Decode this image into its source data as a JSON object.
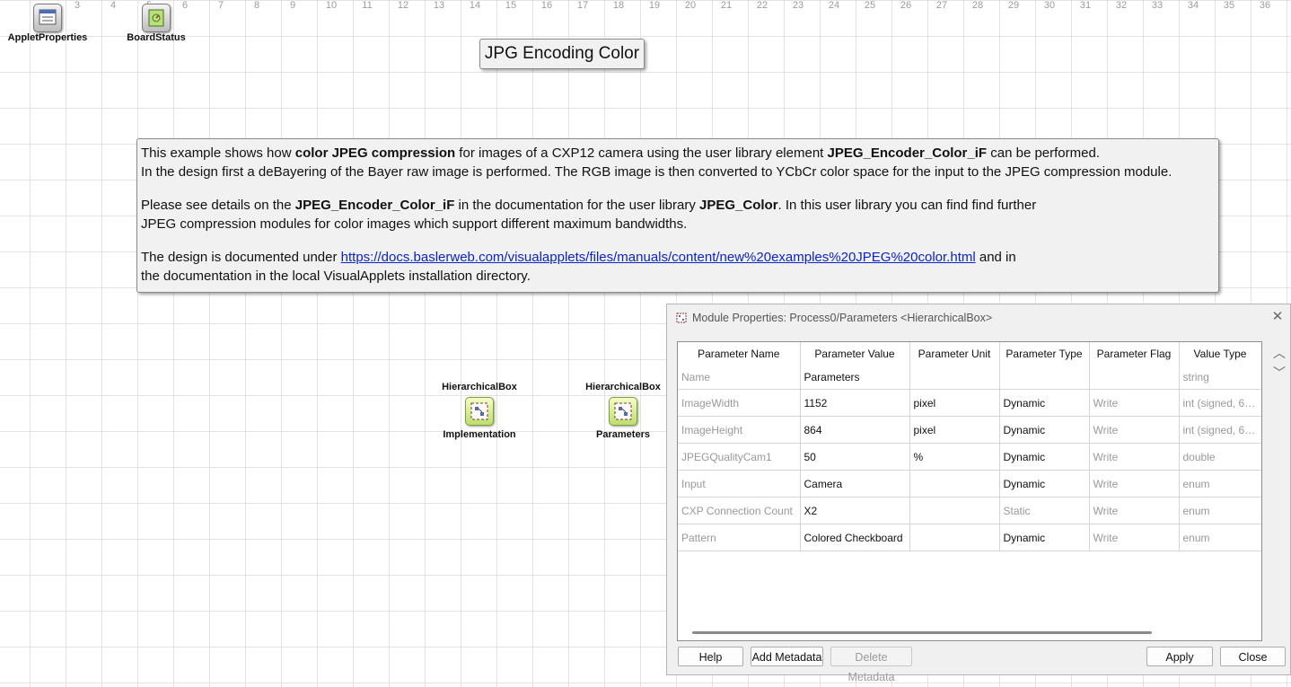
{
  "ruler": [
    "3",
    "4",
    "5",
    "6",
    "7",
    "8",
    "9",
    "10",
    "11",
    "12",
    "13",
    "14",
    "15",
    "16",
    "17",
    "18",
    "19",
    "20",
    "21",
    "22",
    "23",
    "24",
    "25",
    "26",
    "27",
    "28",
    "29",
    "30",
    "31",
    "32",
    "33",
    "34",
    "35",
    "36"
  ],
  "canvas": {
    "modules": {
      "applet_properties": "AppletProperties",
      "board_status": "BoardStatus",
      "hbox1_type": "HierarchicalBox",
      "hbox1_name": "Implementation",
      "hbox2_type": "HierarchicalBox",
      "hbox2_name": "Parameters"
    },
    "title": "JPG Encoding Color",
    "note": {
      "l1_a": "This example shows how ",
      "l1_b": "color JPEG compression",
      "l1_c": " for images of a CXP12 camera using the user library element ",
      "l1_d": "JPEG_Encoder_Color_iF",
      "l1_e": " can be performed.",
      "l2": " In the design first a deBayering of the Bayer raw image is performed. The RGB image is then converted to YCbCr color space for the input to the JPEG compression module.",
      "l3_a": "Please see details on the  ",
      "l3_b": "JPEG_Encoder_Color_iF",
      "l3_c": " in the  documentation for the user library ",
      "l3_d": "JPEG_Color",
      "l3_e": ". In this user library you can find find further",
      "l4": "JPEG compression modules for color images which support different maximum bandwidths.",
      "l5_a": "The design is documented under ",
      "l5_link": "https://docs.baslerweb.com/visualapplets/files/manuals/content/new%20examples%20JPEG%20color.html",
      "l5_b": " and in",
      "l6": "the documentation in the local VisualApplets installation directory."
    }
  },
  "dialog": {
    "title": "Module Properties: Process0/Parameters <HierarchicalBox>",
    "close_glyph": "✕",
    "columns": [
      "Parameter Name",
      "Parameter Value",
      "Parameter Unit",
      "Parameter Type",
      "Parameter Flag",
      "Value Type"
    ],
    "rows": [
      {
        "name": "Name",
        "value": "Parameters",
        "unit": "",
        "type": "",
        "flag": "",
        "vtype": "string"
      },
      {
        "name": "ImageWidth",
        "value": "1152",
        "unit": "pixel",
        "type": "Dynamic",
        "flag": "Write",
        "vtype": "int (signed, 64 ..."
      },
      {
        "name": "ImageHeight",
        "value": "864",
        "unit": "pixel",
        "type": "Dynamic",
        "flag": "Write",
        "vtype": "int (signed, 64 ..."
      },
      {
        "name": "JPEGQualityCam1",
        "value": "50",
        "unit": "%",
        "type": "Dynamic",
        "flag": "Write",
        "vtype": "double"
      },
      {
        "name": "Input",
        "value": "Camera",
        "unit": "",
        "type": "Dynamic",
        "flag": "Write",
        "vtype": "enum"
      },
      {
        "name": "CXP Connection Count",
        "value": "X2",
        "unit": "",
        "type": "Static",
        "flag": "Write",
        "vtype": "enum"
      },
      {
        "name": "Pattern",
        "value": "Colored Checkboard",
        "unit": "",
        "type": "Dynamic",
        "flag": "Write",
        "vtype": "enum"
      }
    ],
    "move_up_glyph": "︿",
    "move_down_glyph": "﹀",
    "buttons": {
      "help": "Help",
      "add_metadata": "Add Metadata",
      "delete_metadata": "Delete Metadata",
      "apply": "Apply",
      "close": "Close"
    }
  }
}
